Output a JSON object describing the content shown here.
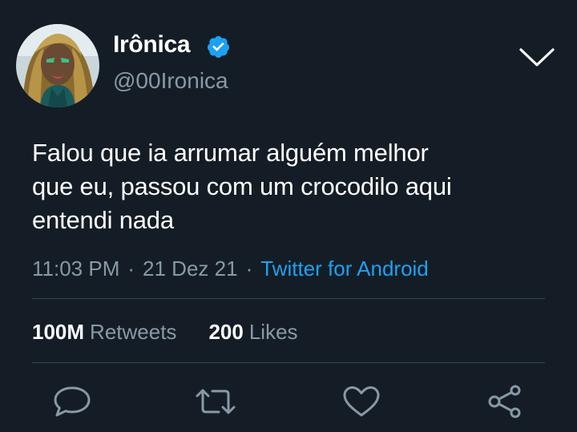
{
  "user": {
    "display_name": "Irônica",
    "handle": "@00Ironica",
    "verified": true,
    "avatar_icon": "profile-photo"
  },
  "tweet": {
    "text_lines": [
      "Falou que ia arrumar alguém melhor",
      "que eu, passou com um crocodilo aqui",
      "entendi nada"
    ],
    "time": "11:03 PM",
    "date": "21 Dez 21",
    "separator": "·",
    "source": "Twitter for Android"
  },
  "stats": {
    "retweets_count": "100M",
    "retweets_label": "Retweets",
    "likes_count": "200",
    "likes_label": "Likes"
  },
  "actions": [
    "reply-icon",
    "retweet-icon",
    "like-icon",
    "share-icon"
  ],
  "colors": {
    "background": "#141d26",
    "text": "#ffffff",
    "secondary": "#8899a6",
    "accent": "#1da1f2",
    "divider": "#38444d"
  }
}
